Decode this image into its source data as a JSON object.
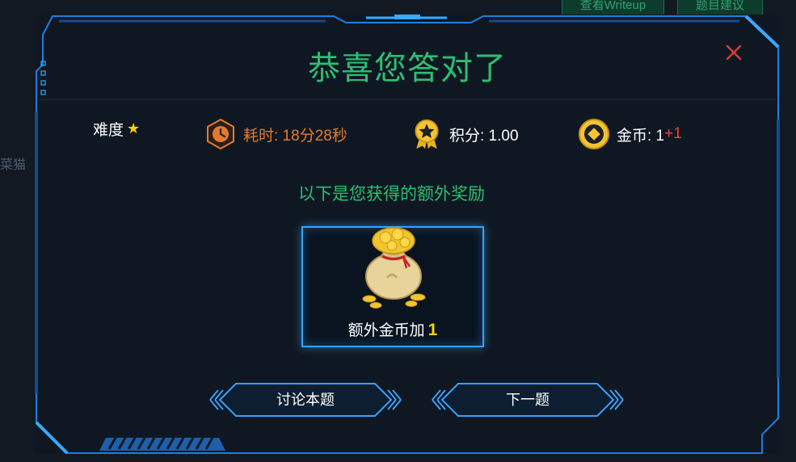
{
  "background": {
    "tab_writeup": "查看Writeup",
    "tab_suggest": "题目建议",
    "side_text": "菜猫"
  },
  "modal": {
    "title": "恭喜您答对了",
    "difficulty_label": "难度",
    "difficulty_stars": 1,
    "time_label": "耗时: 18分28秒",
    "points_label": "积分: 1.00",
    "coins_label": "金币: 1",
    "coins_bonus": "+1",
    "subtitle": "以下是您获得的额外奖励",
    "reward_label": "额外金币加",
    "reward_amount": "1",
    "discuss_button": "讨论本题",
    "next_button": "下一题"
  },
  "colors": {
    "accent_green": "#2bbf73",
    "frame_blue": "#1d7fe0",
    "time_orange": "#e57a2e",
    "gold": "#ffd200",
    "close_red": "#e03a3a"
  }
}
